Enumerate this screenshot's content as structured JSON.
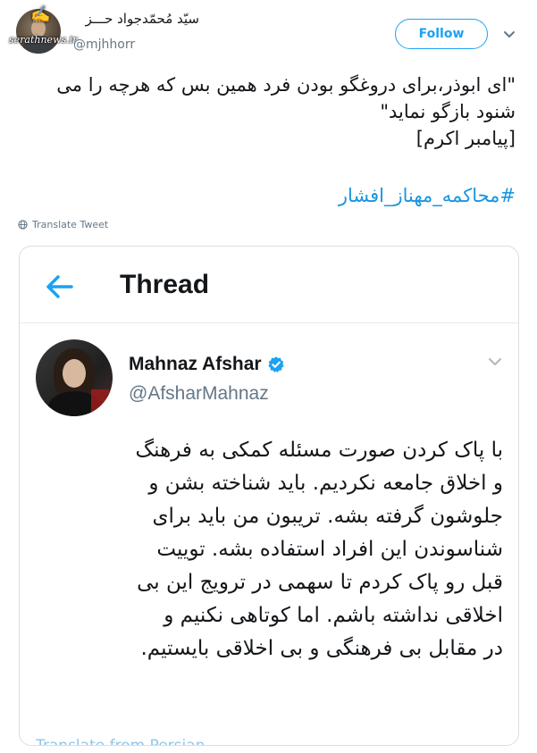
{
  "tweet": {
    "author_name": "سیّد مُحمّدجواد حـــز",
    "author_handle": "@mjhhorr",
    "follow_label": "Follow",
    "text_lines": [
      "\"ای ابوذر،برای دروغگو بودن فرد همین بس که هرچه را می",
      "شنود بازگو نماید\"",
      "[پیامبر اکرم]"
    ],
    "hashtag": "#محاکمه_مهناز_افشار",
    "translate_label": "Translate Tweet"
  },
  "watermark": {
    "text": "serathnews.ir"
  },
  "quoted_card": {
    "header_title": "Thread",
    "author_name": "Mahnaz Afshar",
    "author_handle": "@AfsharMahnaz",
    "text_lines": [
      "با پاک کردن صورت مسئله کمکی به فرهنگ",
      "و اخلاق جامعه نکردیم. باید شناخته بشن و",
      "جلوشون گرفته بشه. تریبون من باید برای",
      "شناسوندن این افراد استفاده بشه. توییت",
      "قبل رو پاک کردم تا سهمی در ترویج این بی",
      "اخلاقی نداشته باشم. اما کوتاهی نکنیم و",
      "در مقابل بی فرهنگی و بی اخلاقی بایستیم."
    ],
    "translate_partial": "Translate from Persian"
  },
  "colors": {
    "accent": "#1da1f2",
    "link": "#1b95e0",
    "muted": "#657786",
    "text": "#14171a",
    "border": "#d8dee4"
  },
  "icons": {
    "back": "arrow-left-icon",
    "verified": "verified-badge-icon",
    "caret": "chevron-down-icon",
    "globe": "globe-icon"
  }
}
